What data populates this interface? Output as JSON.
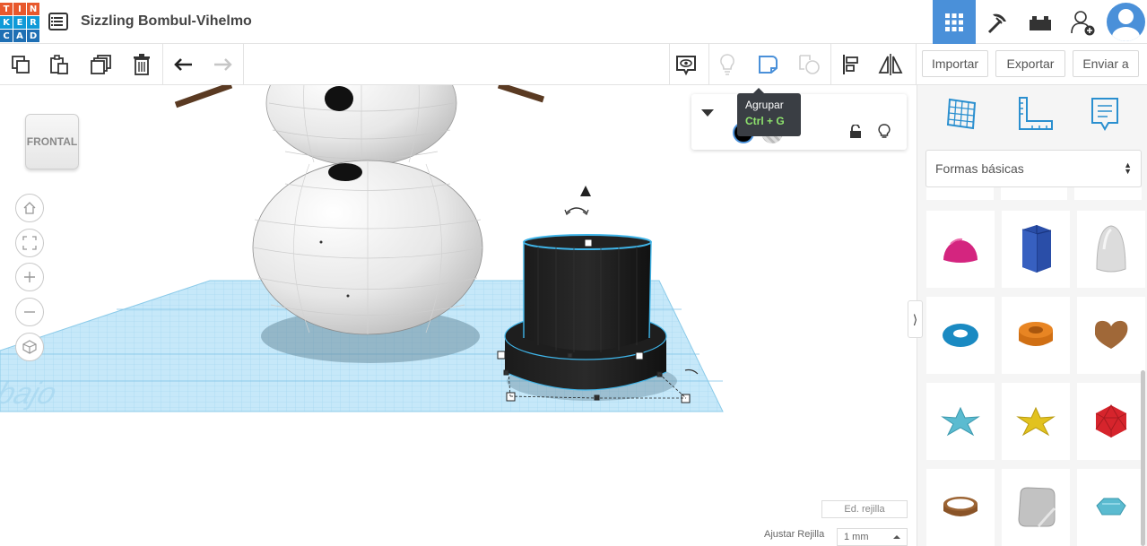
{
  "app": {
    "logo_letters": [
      "T",
      "I",
      "N",
      "K",
      "E",
      "R",
      "C",
      "A",
      "D"
    ],
    "logo_colors": [
      "#e8582d",
      "#e8582d",
      "#e8582d",
      "#0f9ad8",
      "#0f9ad8",
      "#0f9ad8",
      "#1e6fb4",
      "#1e6fb4",
      "#1e6fb4"
    ],
    "title": "Sizzling Bombul-Vihelmo",
    "accent": "#4a90d9"
  },
  "top_nav": {
    "items": [
      {
        "name": "3d-view-icon",
        "active": true
      },
      {
        "name": "blocks-icon",
        "active": false
      },
      {
        "name": "bricks-icon",
        "active": false
      },
      {
        "name": "add-user-icon",
        "active": false
      }
    ]
  },
  "toolbar": {
    "left_tools": [
      "copy-icon",
      "paste-icon",
      "duplicate-icon",
      "delete-icon",
      "undo-icon",
      "redo-icon"
    ],
    "right_tools": [
      "notes-icon",
      "light-icon",
      "group-icon",
      "ungroup-icon",
      "align-icon",
      "mirror-icon"
    ],
    "import_label": "Importar",
    "export_label": "Exportar",
    "send_label": "Enviar a"
  },
  "tooltip": {
    "title": "Agrupar",
    "shortcut": "Ctrl + G"
  },
  "viewcube": {
    "label": "FRONTAL"
  },
  "workplane": {
    "watermark": "e de trabajo"
  },
  "grid": {
    "edit_label": "Ed. rejilla",
    "snap_label": "Ajustar Rejilla",
    "snap_value": "1 mm"
  },
  "panel": {
    "category": "Formas básicas",
    "shapes": [
      {
        "name": "half-sphere",
        "color": "#d4257f"
      },
      {
        "name": "polygon",
        "color": "#2a4ea8"
      },
      {
        "name": "paraboloid",
        "color": "#d9d9d9"
      },
      {
        "name": "torus",
        "color": "#1a8ac2"
      },
      {
        "name": "tube",
        "color": "#e88523"
      },
      {
        "name": "heart",
        "color": "#a06838"
      },
      {
        "name": "star",
        "color": "#5bbbd0"
      },
      {
        "name": "star-gold",
        "color": "#e2c21f"
      },
      {
        "name": "icosahedron",
        "color": "#d6242c"
      },
      {
        "name": "ring",
        "color": "#9c6434"
      },
      {
        "name": "rounded-box",
        "color": "#c2c2c2"
      },
      {
        "name": "gem",
        "color": "#5bbbd0"
      }
    ]
  }
}
